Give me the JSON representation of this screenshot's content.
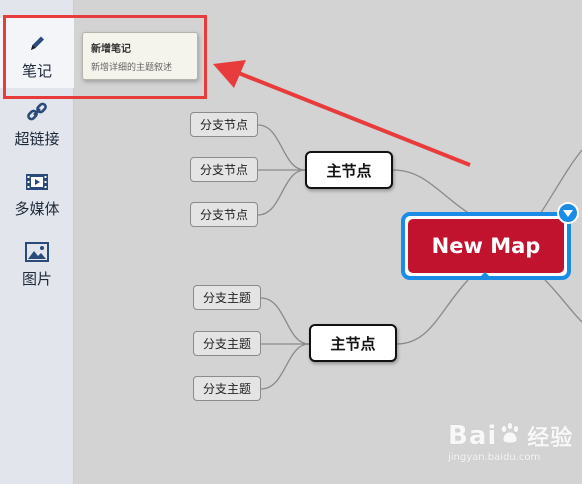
{
  "sidebar": {
    "items": [
      {
        "label": "笔记",
        "icon": "pencil-icon",
        "active": true
      },
      {
        "label": "超链接",
        "icon": "link-icon"
      },
      {
        "label": "多媒体",
        "icon": "film-icon"
      },
      {
        "label": "图片",
        "icon": "image-icon"
      }
    ]
  },
  "tooltip": {
    "title": "新增笔记",
    "description": "新增详细的主题叙述"
  },
  "map": {
    "central": "New Map",
    "main_nodes": [
      "主节点",
      "主节点"
    ],
    "group1_branches": [
      "分支节点",
      "分支节点",
      "分支节点"
    ],
    "group2_branches": [
      "分支主题",
      "分支主题",
      "分支主题"
    ]
  },
  "colors": {
    "central_fill": "#c1132e",
    "selection_blue": "#1a8ce6",
    "annotation_red": "#e83c3c",
    "sidebar_bg": "#e2e5ec",
    "canvas_bg": "#d3d3d4"
  },
  "watermark": {
    "logo_left": "Bai",
    "logo_right": "经验",
    "url": "jingyan.baidu.com"
  }
}
